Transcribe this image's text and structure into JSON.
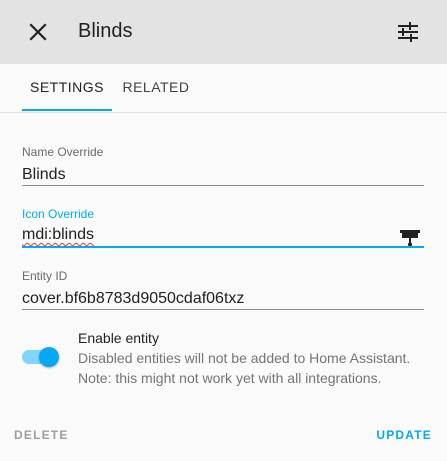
{
  "dialog": {
    "title": "Blinds",
    "close_icon": "close-icon",
    "settings_icon": "tune-icon"
  },
  "tabs": [
    {
      "label": "SETTINGS",
      "active": true
    },
    {
      "label": "RELATED",
      "active": false
    }
  ],
  "form": {
    "name_override": {
      "label": "Name Override",
      "value": "Blinds"
    },
    "icon_override": {
      "label": "Icon Override",
      "value": "mdi:blinds",
      "icon": "blinds-icon"
    },
    "entity_id": {
      "label": "Entity ID",
      "value": "cover.bf6b8783d9050cdaf06txz"
    }
  },
  "enable_entity": {
    "title": "Enable entity",
    "description_line1": "Disabled entities will not be added to Home Assistant.",
    "description_line2": "Note: this might not work yet with all integrations.",
    "enabled": true
  },
  "actions": {
    "delete_label": "DELETE",
    "update_label": "UPDATE"
  },
  "colors": {
    "accent": "#03a9f4",
    "header_bg": "#e3e3e3",
    "background": "#fafafa"
  }
}
